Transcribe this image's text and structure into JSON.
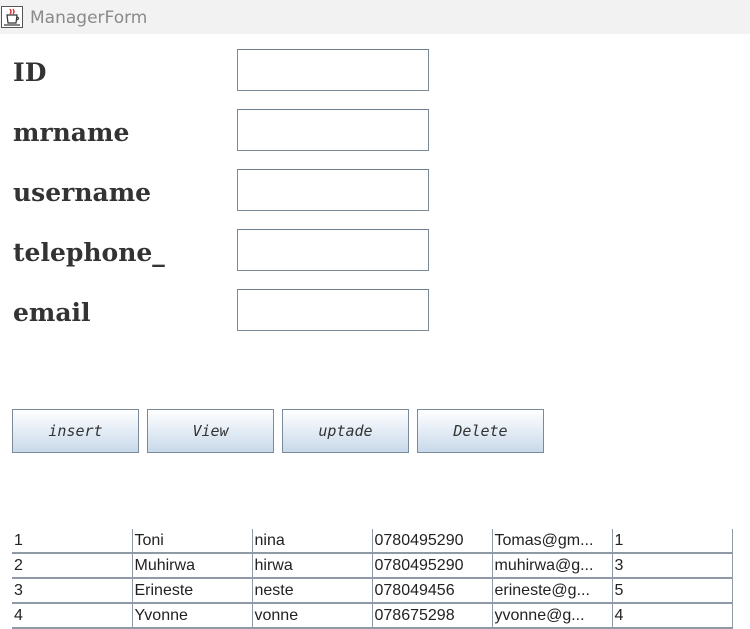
{
  "window": {
    "title": "ManagerForm",
    "icon": "java-coffee-cup-icon"
  },
  "form": {
    "fields": [
      {
        "label": "ID",
        "value": ""
      },
      {
        "label": "mrname",
        "value": ""
      },
      {
        "label": "username",
        "value": ""
      },
      {
        "label": "telephone_",
        "value": ""
      },
      {
        "label": "email",
        "value": ""
      }
    ]
  },
  "buttons": {
    "insert": "insert",
    "view": "View",
    "update": "uptade",
    "delete": "Delete"
  },
  "table": {
    "rows": [
      [
        "1",
        "Toni",
        "nina",
        "0780495290",
        "Tomas@gm...",
        "1"
      ],
      [
        "2",
        "Muhirwa",
        "hirwa",
        "0780495290",
        "muhirwa@g...",
        "3"
      ],
      [
        "3",
        "Erineste",
        "neste",
        "078049456",
        "erineste@g...",
        "5"
      ],
      [
        "4",
        "Yvonne",
        "vonne",
        "078675298",
        "yvonne@g...",
        "4"
      ]
    ]
  },
  "colors": {
    "title_bar": "#f2f2f2",
    "button_gradient_bottom": "#c9d9ea",
    "border": "#7a8a99"
  }
}
